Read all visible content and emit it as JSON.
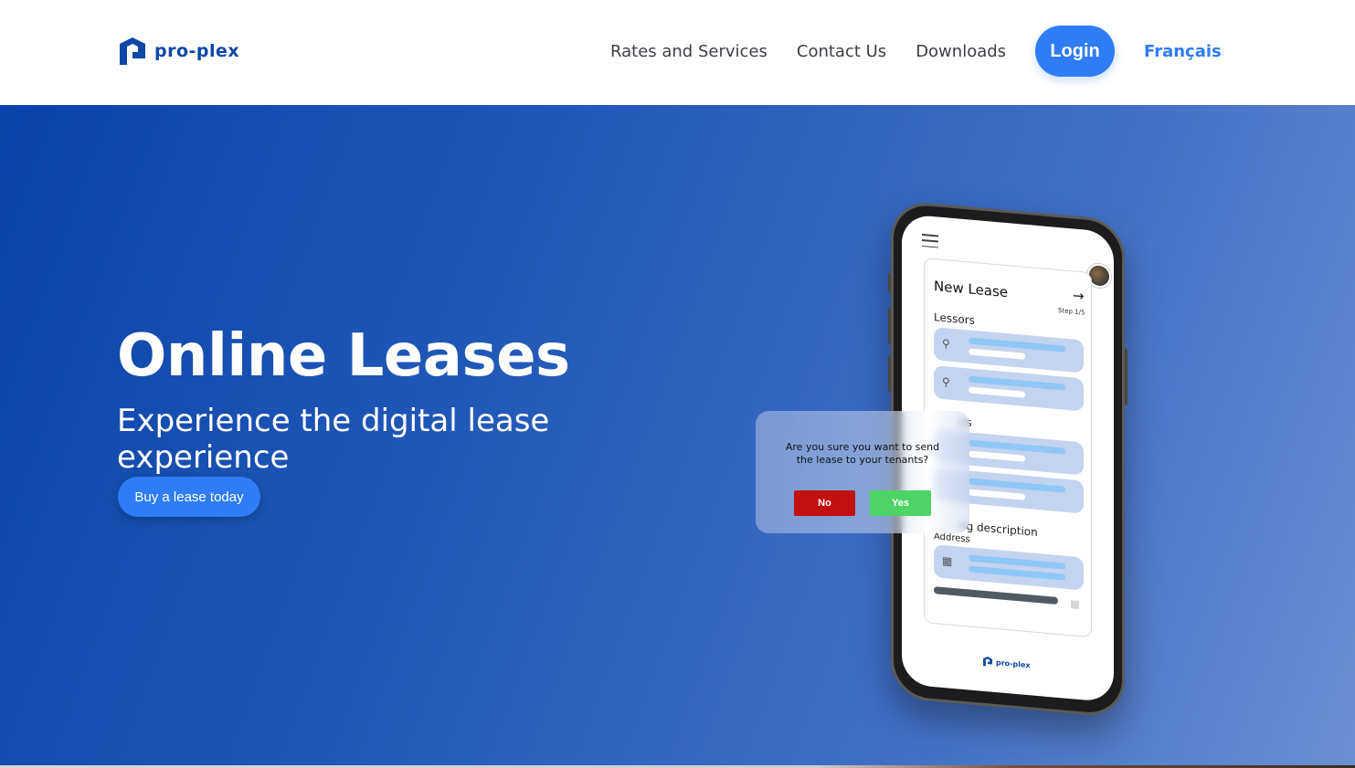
{
  "header": {
    "logo_text": "pro-plex",
    "nav": {
      "rates": "Rates and Services",
      "contact": "Contact Us",
      "downloads": "Downloads"
    },
    "login_label": "Login",
    "language_label": "Français"
  },
  "hero": {
    "title": "Online Leases",
    "subtitle": "Experience the digital lease experience",
    "cta_label": "Buy a lease today"
  },
  "phone": {
    "card_title": "New Lease",
    "step": "Step 1/5",
    "section_lessors": "Lessors",
    "section_lessees_partial": "es",
    "section_building_partial": "ng description",
    "address_label": "Address",
    "logo_text": "pro-plex"
  },
  "dialog": {
    "message": "Are you sure you want to send the lease to your tenants?",
    "no_label": "No",
    "yes_label": "Yes"
  },
  "colors": {
    "brand": "#0d47a8",
    "accent": "#2f7cf6",
    "no_button": "#c21010",
    "yes_button": "#4dd366"
  },
  "icons": [
    "logo-mark",
    "menu-icon",
    "arrow-right-icon",
    "user-icon",
    "building-icon"
  ]
}
